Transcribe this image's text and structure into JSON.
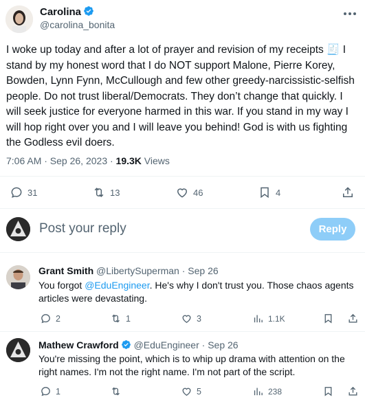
{
  "post": {
    "author_name": "Carolina",
    "author_handle": "@carolina_bonita",
    "text": "I woke up today and after a lot of prayer and revision of my receipts 🧾 I stand by my honest word that I do NOT support Malone, Pierre Korey, Bowden, Lynn Fynn, McCullough and few other greedy-narcissistic-selfish people. Do not trust liberal/Democrats. They don’t change that quickly. I will seek justice for everyone harmed in this war. If you stand in my way I will hop right over you and I will leave you behind! God is with us fighting the Godless evil doers.",
    "timestamp": "7:06 AM · Sep 26, 2023 · ",
    "views_count": "19.3K",
    "views_label": " Views",
    "replies": "31",
    "reposts": "13",
    "likes": "46",
    "bookmarks": "4"
  },
  "composer": {
    "placeholder": "Post your reply",
    "reply_button": "Reply"
  },
  "replies": [
    {
      "name": "Grant Smith",
      "handle": "@LibertySuperman",
      "date": " · Sep 26",
      "text_before": "You forgot ",
      "mention": "@EduEngineer",
      "text_after": ". He's why I don't trust you. Those chaos agents articles were devastating.",
      "replies": "2",
      "reposts": "1",
      "likes": "3",
      "views": "1.1K"
    },
    {
      "name": "Mathew Crawford",
      "handle": "@EduEngineer",
      "date": " · Sep 26",
      "text": "You're missing the point, which is to whip up drama with attention on the right names. I'm not the right name. I'm not part of the script.",
      "replies": "1",
      "reposts": "",
      "likes": "5",
      "views": "238"
    }
  ],
  "colors": {
    "accent": "#1d9bf0",
    "muted": "#536471",
    "reply_button_disabled": "#8ecdf8"
  }
}
